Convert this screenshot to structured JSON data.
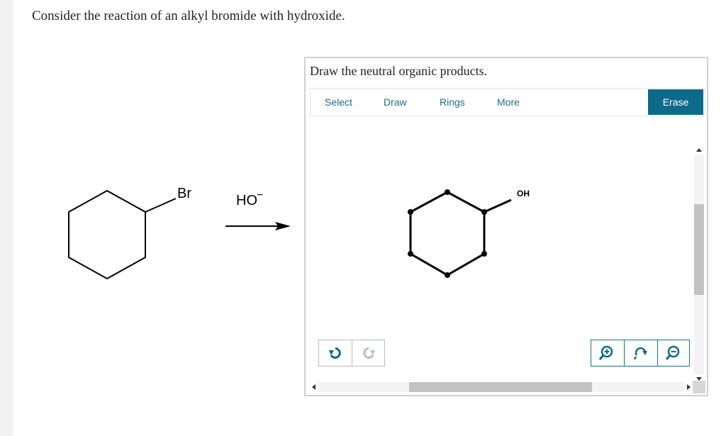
{
  "question": {
    "text": "Consider the reaction of an alkyl bromide with hydroxide."
  },
  "reaction": {
    "reactant_substituent": "Br",
    "reagent": "HO",
    "reagent_charge": "−"
  },
  "editor": {
    "title": "Draw the neutral organic products.",
    "toolbar": {
      "select": "Select",
      "draw": "Draw",
      "rings": "Rings",
      "more": "More",
      "erase": "Erase"
    },
    "product_substituent": "OH",
    "icons": {
      "undo": "undo-icon",
      "redo": "redo-icon",
      "zoom_in": "zoom-in-icon",
      "reset_zoom": "reset-zoom-icon",
      "zoom_out": "zoom-out-icon"
    },
    "colors": {
      "accent": "#0e6a8a",
      "link": "#1b6f8a"
    }
  }
}
